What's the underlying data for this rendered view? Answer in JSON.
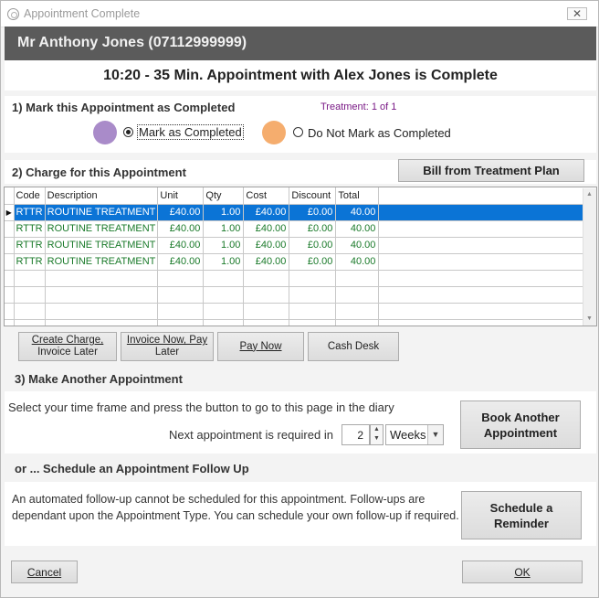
{
  "window": {
    "title": "Appointment Complete",
    "close_glyph": "✕"
  },
  "patient": {
    "name": "Mr Anthony Jones (07112999999)"
  },
  "appointment": {
    "summary": "10:20 - 35 Min. Appointment with Alex Jones is Complete"
  },
  "section1": {
    "heading": "1) Mark this Appointment as Completed",
    "treatment_count": "Treatment: 1 of 1",
    "option_completed": "Mark as Completed",
    "option_not_completed": "Do Not Mark as Completed",
    "selected": "completed",
    "completed_color": "#a98bc9",
    "not_completed_color": "#f5ad6e"
  },
  "section2": {
    "heading": "2) Charge for this Appointment",
    "bill_button": "Bill from Treatment Plan",
    "columns": [
      "Code",
      "Description",
      "Unit",
      "Qty",
      "Cost",
      "Discount",
      "Total"
    ],
    "rows": [
      [
        "RTTR",
        "ROUTINE TREATMENT",
        "£40.00",
        "1.00",
        "£40.00",
        "£0.00",
        "40.00"
      ],
      [
        "RTTR",
        "ROUTINE TREATMENT",
        "£40.00",
        "1.00",
        "£40.00",
        "£0.00",
        "40.00"
      ],
      [
        "RTTR",
        "ROUTINE TREATMENT",
        "£40.00",
        "1.00",
        "£40.00",
        "£0.00",
        "40.00"
      ],
      [
        "RTTR",
        "ROUTINE TREATMENT",
        "£40.00",
        "1.00",
        "£40.00",
        "£0.00",
        "40.00"
      ]
    ],
    "selected_row": 0,
    "selection_color": "#0b74d6",
    "actions": {
      "create_charge": {
        "line1": "Create Charge,",
        "line2": "Invoice Later"
      },
      "invoice_now": {
        "line1": "Invoice Now, Pay",
        "line2": "Later"
      },
      "pay_now": "Pay Now",
      "cash_desk": "Cash Desk"
    }
  },
  "section3": {
    "heading": "3) Make Another Appointment",
    "instruction": "Select your time frame and press the button to go to this page in the diary",
    "next_label": "Next appointment is required in",
    "next_value": "2",
    "unit": "Weeks",
    "book_button": {
      "line1": "Book Another",
      "line2": "Appointment"
    }
  },
  "section4": {
    "heading": "or ... Schedule an Appointment Follow Up",
    "message": "An automated follow-up cannot be scheduled for this appointment. Follow-ups are dependant upon the Appointment Type. You can schedule your own follow-up if required.",
    "reminder_button": {
      "line1": "Schedule a",
      "line2": "Reminder"
    }
  },
  "footer": {
    "cancel": "Cancel",
    "ok": "OK"
  }
}
